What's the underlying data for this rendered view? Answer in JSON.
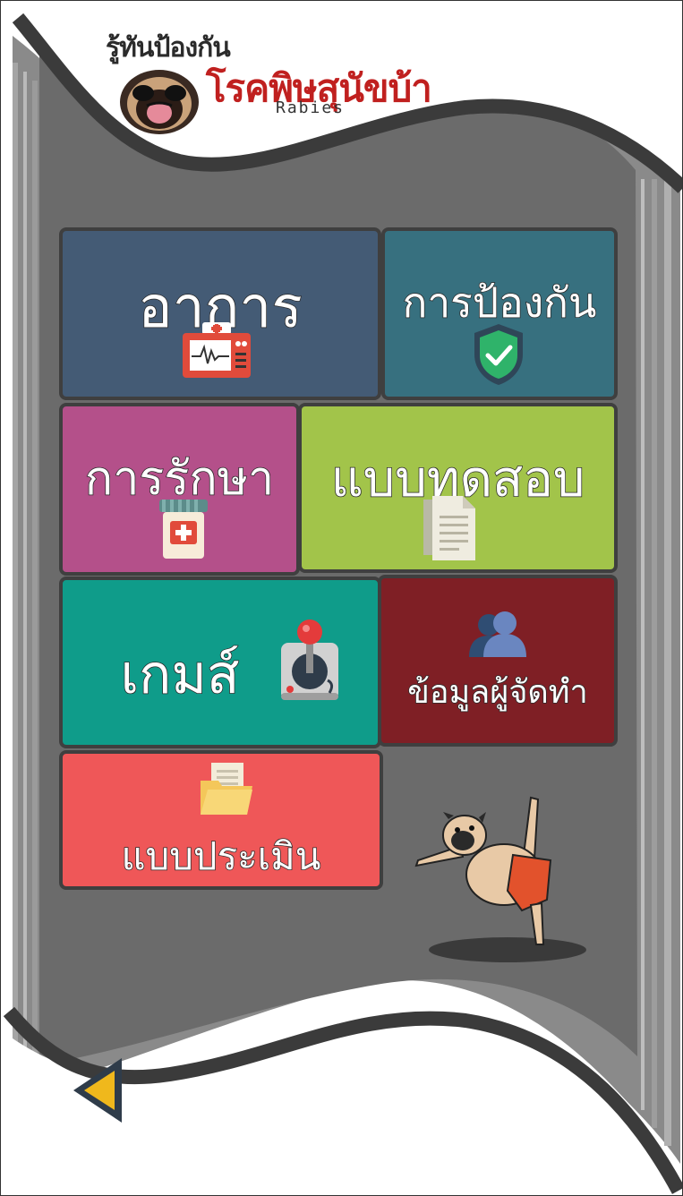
{
  "header": {
    "title_small": "รู้ทันป้องกัน",
    "title_big": "โรคพิษสุนัขบ้า",
    "title_en": "Rabies"
  },
  "menu": {
    "symptoms": {
      "label": "อาการ",
      "icon": "medical-monitor-icon"
    },
    "prevention": {
      "label": "การป้องกัน",
      "icon": "shield-check-icon"
    },
    "treatment": {
      "label": "การรักษา",
      "icon": "medicine-bottle-icon"
    },
    "quiz": {
      "label": "แบบทดสอบ",
      "icon": "document-icon"
    },
    "game": {
      "label": "เกมส์",
      "icon": "joystick-icon"
    },
    "credits": {
      "label": "ข้อมูลผู้จัดทำ",
      "icon": "people-icon"
    },
    "evaluation": {
      "label": "แบบประเมิน",
      "icon": "folder-icon"
    }
  },
  "navigation": {
    "back_icon": "back-triangle-icon"
  },
  "colors": {
    "symptoms": "#445b75",
    "prevention": "#37707f",
    "treatment": "#b4508a",
    "quiz": "#a2c44a",
    "game": "#0f9c8a",
    "credits": "#7f1f25",
    "evaluation": "#ef5758",
    "title_red": "#c0201f",
    "panel_gray": "#6b6b6b"
  }
}
